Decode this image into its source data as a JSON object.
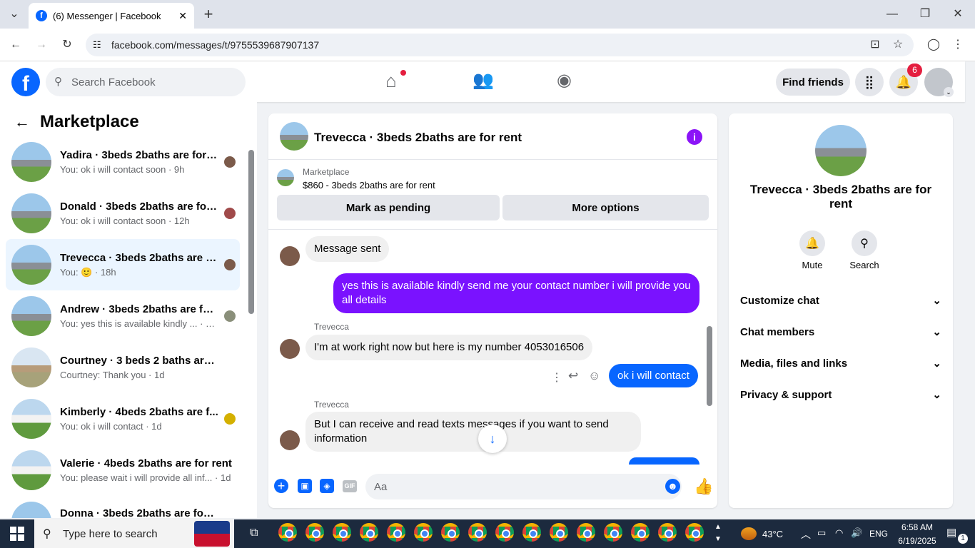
{
  "browser": {
    "tab_title": "(6) Messenger | Facebook",
    "url": "facebook.com/messages/t/9755539687907137"
  },
  "header": {
    "search_placeholder": "Search Facebook",
    "find_friends": "Find friends",
    "notification_count": "6"
  },
  "sidebar": {
    "title": "Marketplace",
    "conversations": [
      {
        "name": "Yadira · 3beds 2baths are for r...",
        "preview": "You: ok i will contact soon · 9h"
      },
      {
        "name": "Donald · 3beds 2baths are for...",
        "preview": "You: ok i will contact soon · 12h"
      },
      {
        "name": "Trevecca · 3beds 2baths are fo...",
        "preview": "You: 🙂 · 18h"
      },
      {
        "name": "Andrew · 3beds 2baths are for...",
        "preview": "You: yes this is available kindly ... · 18h"
      },
      {
        "name": "Courtney · 3 beds 2 baths are fo...",
        "preview": "Courtney: Thank you · 1d"
      },
      {
        "name": "Kimberly · 4beds 2baths are f...",
        "preview": "You: ok i will contact · 1d"
      },
      {
        "name": "Valerie · 4beds 2baths are for rent",
        "preview": "You: please wait i will provide all inf... · 1d"
      },
      {
        "name": "Donna · 3beds 2baths are for ...",
        "preview": ""
      }
    ]
  },
  "chat": {
    "title": "Trevecca · 3beds 2baths are for rent",
    "listing_source": "Marketplace",
    "listing_title": "$860 - 3beds 2baths are for rent",
    "mark_pending": "Mark as pending",
    "more_options": "More options",
    "messages": [
      {
        "text": "Message sent"
      },
      {
        "text": "yes  this is available kindly send me your contact number i will provide you all details"
      },
      {
        "sender": "Trevecca",
        "text": "I'm at work right now but here is my number 4053016506"
      },
      {
        "text": "ok i will contact"
      },
      {
        "sender": "Trevecca",
        "text": "But I can receive and read texts messages if you want to send information"
      }
    ],
    "composer_placeholder": "Aa",
    "gif_label": "GIF"
  },
  "details": {
    "name": "Trevecca · 3beds 2baths are for rent",
    "mute": "Mute",
    "search": "Search",
    "sections": [
      "Customize chat",
      "Chat members",
      "Media, files and links",
      "Privacy & support"
    ]
  },
  "taskbar": {
    "search_placeholder": "Type here to search",
    "temperature": "43°C",
    "language": "ENG",
    "time": "6:58 AM",
    "date": "6/19/2025",
    "notif_count": "1"
  },
  "colors": {
    "accent": "#0866ff",
    "outgoing": "#7a12ff",
    "fb_blue": "#0866ff"
  }
}
